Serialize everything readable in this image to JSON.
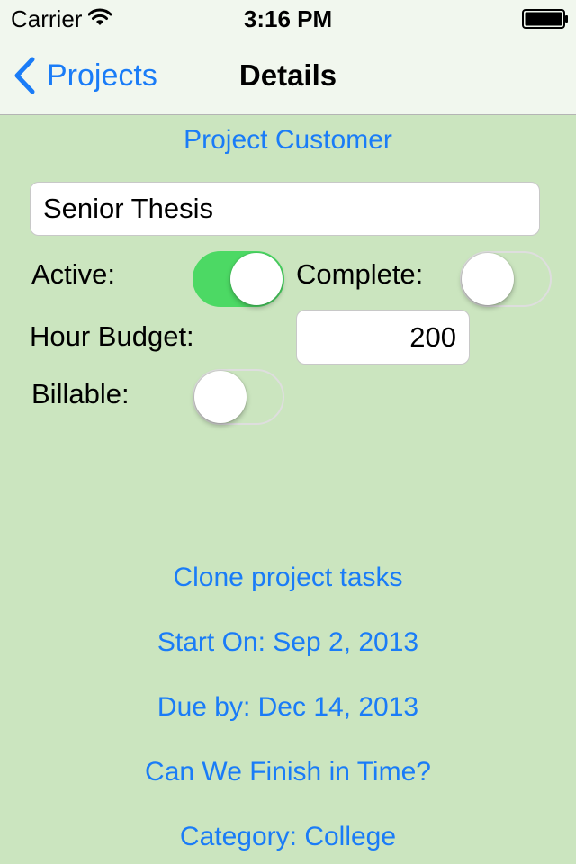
{
  "status_bar": {
    "carrier": "Carrier",
    "time": "3:16 PM",
    "icons": [
      "wifi-icon",
      "battery-icon"
    ]
  },
  "nav": {
    "back_label": "Projects",
    "back_icon": "chevron-left-icon",
    "title": "Details"
  },
  "form": {
    "customer_button": "Project Customer",
    "project_name": "Senior Thesis",
    "active_label": "Active:",
    "active_on": true,
    "complete_label": "Complete:",
    "complete_on": false,
    "hour_budget_label": "Hour Budget:",
    "hour_budget_value": "200",
    "billable_label": "Billable:",
    "billable_on": false
  },
  "actions": {
    "clone_tasks": "Clone project tasks",
    "start_on": "Start On: Sep 2, 2013",
    "due_by": "Due by: Dec 14, 2013",
    "can_finish": "Can We Finish in Time?",
    "category": "Category: College"
  },
  "colors": {
    "background": "#cbe5bf",
    "bar": "#f1f7ee",
    "accent": "#1a7cf7",
    "switch_on": "#4cd964"
  }
}
